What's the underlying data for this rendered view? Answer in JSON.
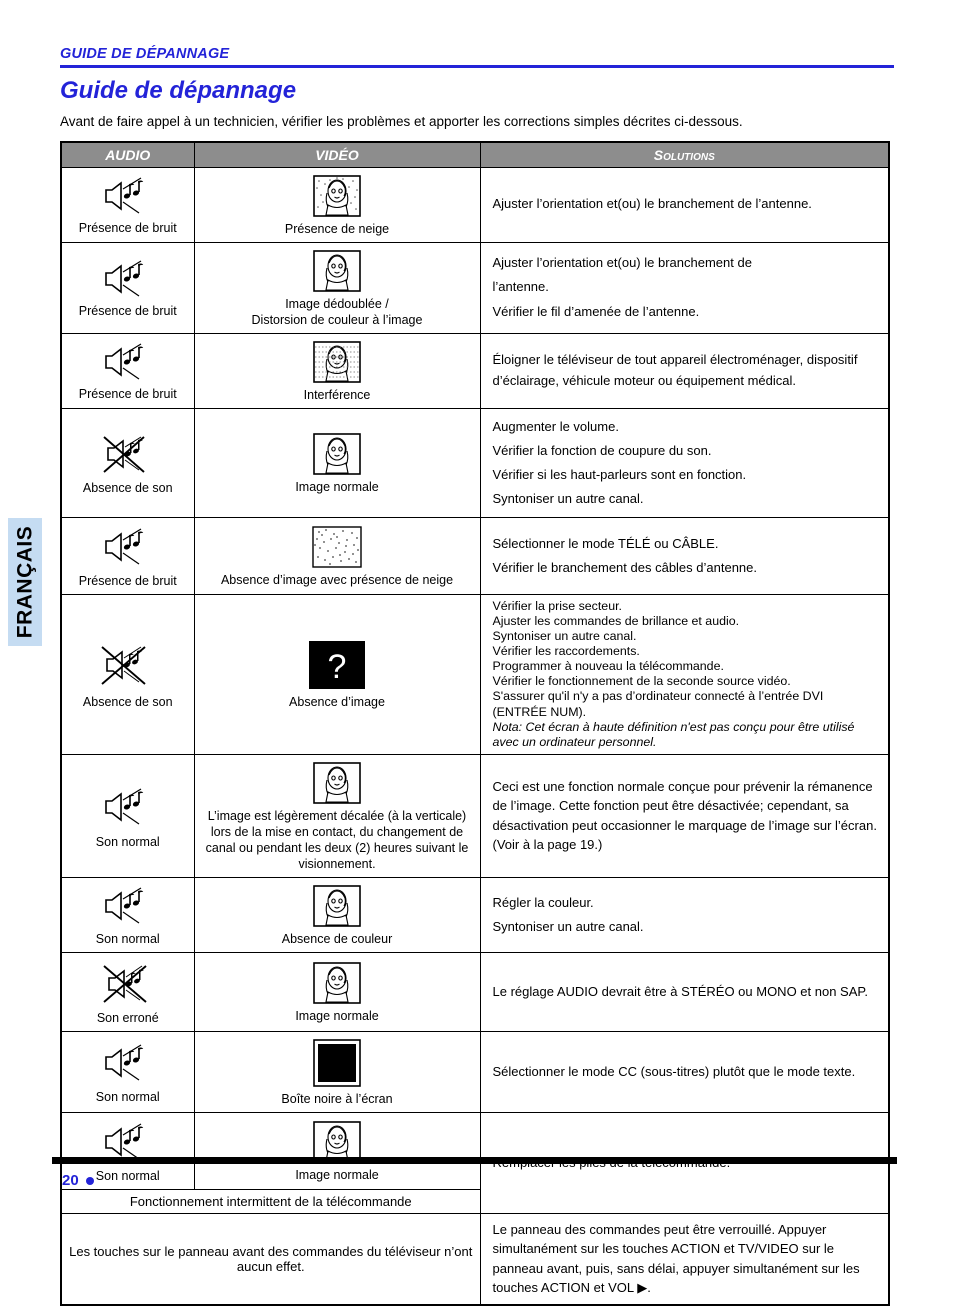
{
  "sidebar": {
    "language_tab": "FRANÇAIS"
  },
  "header": {
    "kicker": "GUIDE DE DÉPANNAGE",
    "title": "Guide de dépannage",
    "intro": "Avant de faire appel à un technicien, vérifier les problèmes et apporter les corrections simples décrites ci-dessous."
  },
  "table": {
    "columns": [
      "AUDIO",
      "VIDÉO",
      "Solutions"
    ],
    "rows": [
      {
        "audio_icon": "speaker-noise-icon",
        "audio_label": "Présence de bruit",
        "video_icon": "tv-snow-icon",
        "video_label": "Présence de neige",
        "solutions": [
          "Ajuster l’orientation et(ou) le branchement de l’antenne."
        ]
      },
      {
        "audio_icon": "speaker-noise-icon",
        "audio_label": "Présence de bruit",
        "video_icon": "tv-ghost-icon",
        "video_label": "Image dédoublée /\nDistorsion de couleur à l’image",
        "video_label_line1": "Image dédoublée /",
        "video_label_line2": "Distorsion de couleur à l’image",
        "solutions": [
          "Ajuster l’orientation et(ou) le  branchement de",
          "l’antenne.",
          "Vérifier le fil d’amenée de l’antenne."
        ]
      },
      {
        "audio_icon": "speaker-noise-icon",
        "audio_label": "Présence de bruit",
        "video_icon": "tv-interference-icon",
        "video_label": "Interférence",
        "solutions": [
          "Éloigner le téléviseur de tout appareil électroménager, dispositif d’éclairage, véhicule moteur ou équipement médical."
        ]
      },
      {
        "audio_icon": "speaker-muted-icon",
        "audio_label": "Absence de son",
        "video_icon": "tv-normal-icon",
        "video_label": "Image normale",
        "solutions": [
          "Augmenter le volume.",
          "Vérifier la fonction de coupure du son.",
          "Vérifier si les haut-parleurs sont en fonction.",
          "Syntoniser un autre canal."
        ]
      },
      {
        "audio_icon": "speaker-noise-icon",
        "audio_label": "Présence de bruit",
        "video_icon": "tv-snow-only-icon",
        "video_label": "Absence d’image avec présence de neige",
        "solutions": [
          "Sélectionner le mode TÉLÉ ou CÂBLE.",
          "Vérifier le branchement des câbles d’antenne."
        ]
      },
      {
        "audio_icon": "speaker-muted-icon",
        "audio_label": "Absence de son",
        "video_icon": "tv-question-icon",
        "video_label": "Absence d’image",
        "solutions": [
          "Vérifier la prise secteur.",
          "Ajuster les commandes de brillance et audio.",
          "Syntoniser un autre canal.",
          "Vérifier les raccordements.",
          "Programmer à nouveau la télécommande.",
          "Vérifier le fonctionnement de la seconde source vidéo.",
          "S'assurer qu'il n'y a pas d’ordinateur connecté à l’entrée DVI",
          " (ENTRÉE NUM)."
        ],
        "note": "Nota:  Cet écran à haute définition n'est pas conçu pour être utilisé avec un ordinateur personnel."
      },
      {
        "audio_icon": "speaker-normal-icon",
        "audio_label": "Son normal",
        "video_icon": "tv-normal-icon",
        "video_label": "L’image est légèrement décalée (à la verticale) lors de la mise en contact, du changement de canal ou pendant les deux (2) heures suivant le visionnement.",
        "solutions": [
          "Ceci est une fonction normale conçue pour prévenir la rémanence de l’image. Cette fonction peut être désactivée; cependant, sa désactivation peut occasionner le marquage de l’image sur l’écran. (Voir à la page 19.)"
        ]
      },
      {
        "audio_icon": "speaker-normal-icon",
        "audio_label": "Son normal",
        "video_icon": "tv-normal-icon",
        "video_label": "Absence de couleur",
        "solutions": [
          "Régler la couleur.",
          "Syntoniser un autre canal."
        ]
      },
      {
        "audio_icon": "speaker-muted-icon",
        "audio_label": "Son erroné",
        "video_icon": "tv-normal-icon",
        "video_label": "Image normale",
        "solutions": [
          "Le réglage AUDIO devrait être à STÉRÉO ou MONO et non SAP."
        ]
      },
      {
        "audio_icon": "speaker-normal-icon",
        "audio_label": "Son normal",
        "video_icon": "tv-black-box-icon",
        "video_label": "Boîte noire à l’écran",
        "solutions": [
          "Sélectionner le mode CC (sous-titres) plutôt que le mode texte."
        ]
      },
      {
        "audio_icon": "speaker-normal-icon",
        "audio_label": "Son normal",
        "video_icon": "tv-normal-icon",
        "video_label": "Image normale",
        "span_label": "Fonctionnement intermittent de la télécommande",
        "solutions": [
          "Remplacer les piles de la télécommande."
        ]
      },
      {
        "span_label": "Les touches sur le panneau avant des commandes du téléviseur n’ont aucun effet.",
        "solutions": [
          "Le panneau des commandes peut être verrouillé. Appuyer simultanément sur les touches ACTION et TV/VIDEO sur le panneau avant, puis, sans délai, appuyer simultanément sur les touches ACTION et VOL ▶."
        ]
      }
    ]
  },
  "footer": {
    "page_number": "20"
  },
  "colors": {
    "accent": "#2323d8",
    "header_gray": "#8d8d8d",
    "lang_tab": "#c5dcf2"
  }
}
